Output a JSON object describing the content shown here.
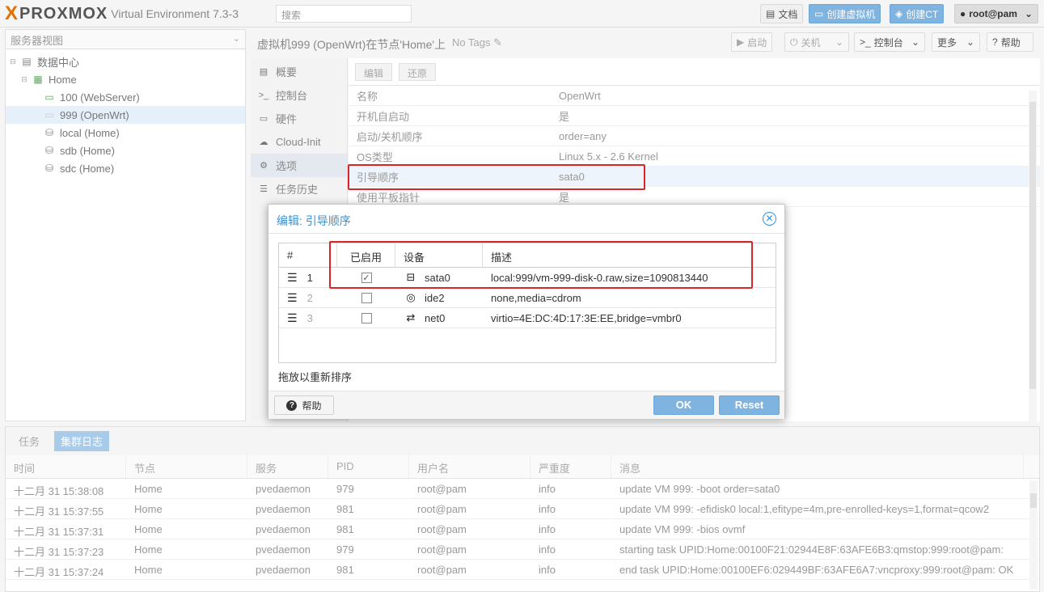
{
  "topbar": {
    "brand_x": "X",
    "brand": "PROXMOX",
    "version": "Virtual Environment 7.3-3",
    "search_placeholder": "搜索",
    "docs": "文档",
    "create_vm": "创建虚拟机",
    "create_ct": "创建CT",
    "user": "root@pam"
  },
  "tree": {
    "header": "服务器视图",
    "items": [
      {
        "label": "数据中心",
        "icon": "datacenter-icon"
      },
      {
        "label": "Home",
        "icon": "node-icon"
      },
      {
        "label": "100 (WebServer)",
        "icon": "vm-running-icon"
      },
      {
        "label": "999 (OpenWrt)",
        "icon": "vm-stopped-icon"
      },
      {
        "label": "local (Home)",
        "icon": "storage-icon"
      },
      {
        "label": "sdb (Home)",
        "icon": "storage-icon"
      },
      {
        "label": "sdc (Home)",
        "icon": "storage-icon"
      }
    ]
  },
  "main": {
    "title": "虚拟机999 (OpenWrt)在节点'Home'上",
    "no_tags": "No Tags",
    "start": "启动",
    "shutdown": "关机",
    "console": "控制台",
    "more": "更多",
    "help": "帮助"
  },
  "side_menu": [
    {
      "label": "概要",
      "icon": "summary-icon"
    },
    {
      "label": "控制台",
      "icon": "console-icon"
    },
    {
      "label": "硬件",
      "icon": "hardware-icon"
    },
    {
      "label": "Cloud-Init",
      "icon": "cloud-icon"
    },
    {
      "label": "选项",
      "icon": "gear-icon"
    },
    {
      "label": "任务历史",
      "icon": "list-icon"
    }
  ],
  "options": {
    "edit": "编辑",
    "revert": "还原",
    "rows": [
      {
        "k": "名称",
        "v": "OpenWrt"
      },
      {
        "k": "开机自启动",
        "v": "是"
      },
      {
        "k": "启动/关机顺序",
        "v": "order=any"
      },
      {
        "k": "OS类型",
        "v": "Linux 5.x - 2.6 Kernel"
      },
      {
        "k": "引导顺序",
        "v": "sata0"
      },
      {
        "k": "使用平板指针",
        "v": "是"
      }
    ]
  },
  "log": {
    "tabs": [
      "任务",
      "集群日志"
    ],
    "headers": [
      "时间",
      "节点",
      "服务",
      "PID",
      "用户名",
      "严重度",
      "消息"
    ],
    "rows": [
      [
        "十二月 31 15:38:08",
        "Home",
        "pvedaemon",
        "979",
        "root@pam",
        "info",
        "update VM 999: -boot order=sata0"
      ],
      [
        "十二月 31 15:37:55",
        "Home",
        "pvedaemon",
        "981",
        "root@pam",
        "info",
        "update VM 999: -efidisk0 local:1,efitype=4m,pre-enrolled-keys=1,format=qcow2"
      ],
      [
        "十二月 31 15:37:31",
        "Home",
        "pvedaemon",
        "981",
        "root@pam",
        "info",
        "update VM 999: -bios ovmf"
      ],
      [
        "十二月 31 15:37:23",
        "Home",
        "pvedaemon",
        "979",
        "root@pam",
        "info",
        "starting task UPID:Home:00100F21:02944E8F:63AFE6B3:qmstop:999:root@pam:"
      ],
      [
        "十二月 31 15:37:24",
        "Home",
        "pvedaemon",
        "981",
        "root@pam",
        "info",
        "end task UPID:Home:00100EF6:029449BF:63AFE6A7:vncproxy:999:root@pam: OK"
      ]
    ]
  },
  "modal": {
    "title": "编辑: 引导顺序",
    "headers": [
      "#",
      "已启用",
      "设备",
      "描述"
    ],
    "rows": [
      {
        "n": "1",
        "checked": true,
        "device": "sata0",
        "icon": "hdd-icon",
        "desc": "local:999/vm-999-disk-0.raw,size=1090813440"
      },
      {
        "n": "2",
        "checked": false,
        "device": "ide2",
        "icon": "cdrom-icon",
        "desc": "none,media=cdrom"
      },
      {
        "n": "3",
        "checked": false,
        "device": "net0",
        "icon": "network-icon",
        "desc": "virtio=4E:DC:4D:17:3E:EE,bridge=vmbr0"
      }
    ],
    "hint": "拖放以重新排序",
    "help": "帮助",
    "ok": "OK",
    "reset": "Reset"
  }
}
